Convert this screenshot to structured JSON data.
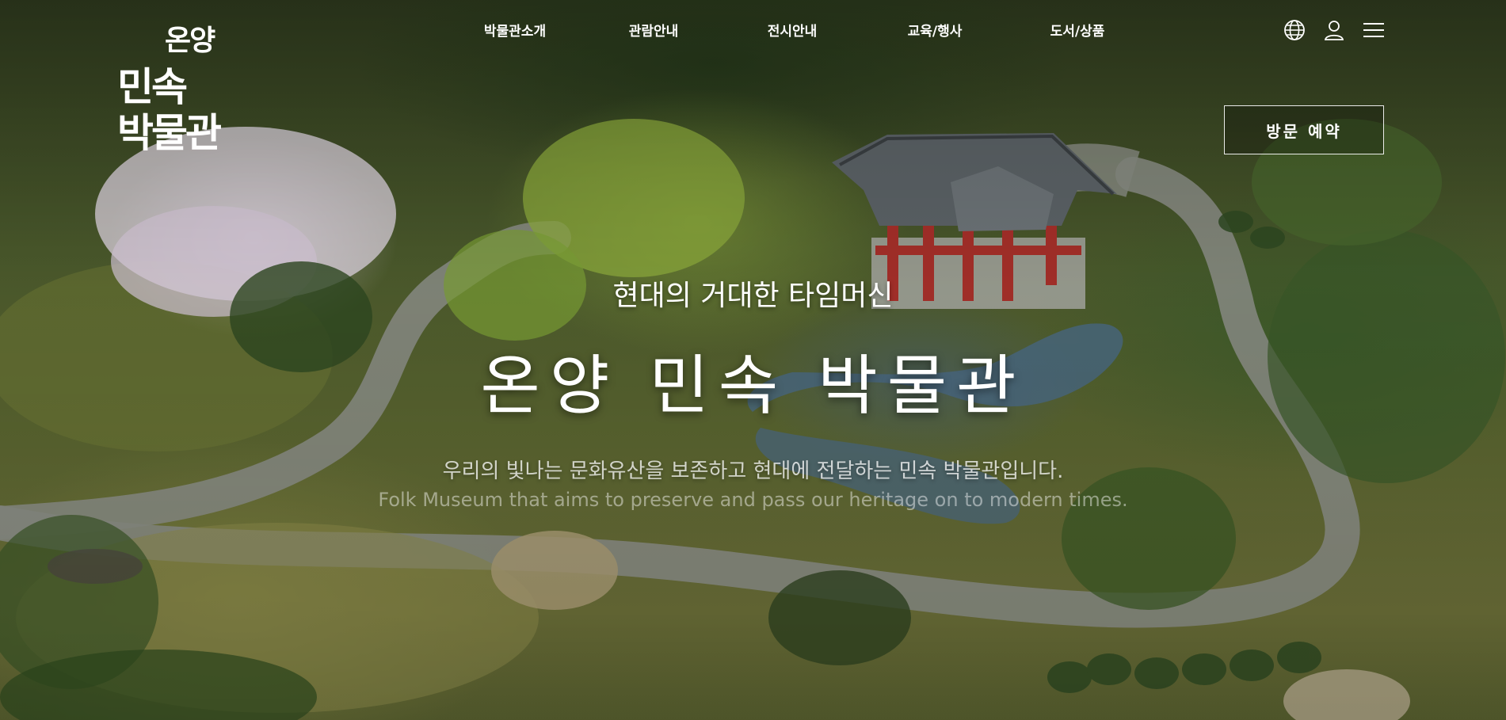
{
  "logo": {
    "line1": "온양",
    "line2": "민속",
    "line3": "박물관"
  },
  "nav": {
    "items": [
      {
        "label": "박물관소개"
      },
      {
        "label": "관람안내"
      },
      {
        "label": "전시안내"
      },
      {
        "label": "교육/행사"
      },
      {
        "label": "도서/상품"
      }
    ]
  },
  "util": {
    "icons": [
      "globe-icon",
      "user-icon",
      "menu-icon"
    ]
  },
  "reserve_button": {
    "label": "방문 예약"
  },
  "hero": {
    "subtitle": "현대의 거대한 타임머신",
    "title": "온양 민속 박물관",
    "description_ko": "우리의 빛나는 문화유산을 보존하고 현대에 전달하는 민속 박물관입니다.",
    "description_en": "Folk Museum that aims to preserve and pass our heritage on to modern times."
  },
  "colors": {
    "text": "#ffffff",
    "pavilion_roof": "#5d6468",
    "pavilion_pillar": "#a8302a",
    "path": "#8a8d84",
    "pond": "#4a6a86"
  }
}
